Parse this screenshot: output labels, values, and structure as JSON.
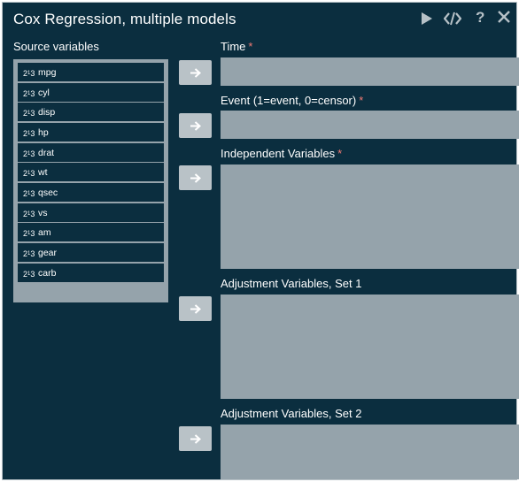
{
  "window": {
    "title": "Cox Regression, multiple models"
  },
  "toolbar": {
    "run_icon": "play-icon",
    "code_icon": "code-icon",
    "help_icon": "help-icon",
    "help_text": "?",
    "close_icon": "close-icon"
  },
  "source": {
    "label": "Source variables",
    "variables": [
      "mpg",
      "cyl",
      "disp",
      "hp",
      "drat",
      "wt",
      "qsec",
      "vs",
      "am",
      "gear",
      "carb"
    ]
  },
  "targets": {
    "time": {
      "label": "Time",
      "required": "*"
    },
    "event": {
      "label": "Event (1=event, 0=censor)",
      "required": "*"
    },
    "independent": {
      "label": "Independent Variables",
      "required": "*"
    },
    "adjust1": {
      "label": "Adjustment Variables, Set 1"
    },
    "adjust2": {
      "label": "Adjustment Variables, Set 2"
    }
  },
  "colors": {
    "background": "#0b2e3f",
    "panel": "#95a3ab",
    "button": "#b9c2c7",
    "required": "#f07a74"
  }
}
